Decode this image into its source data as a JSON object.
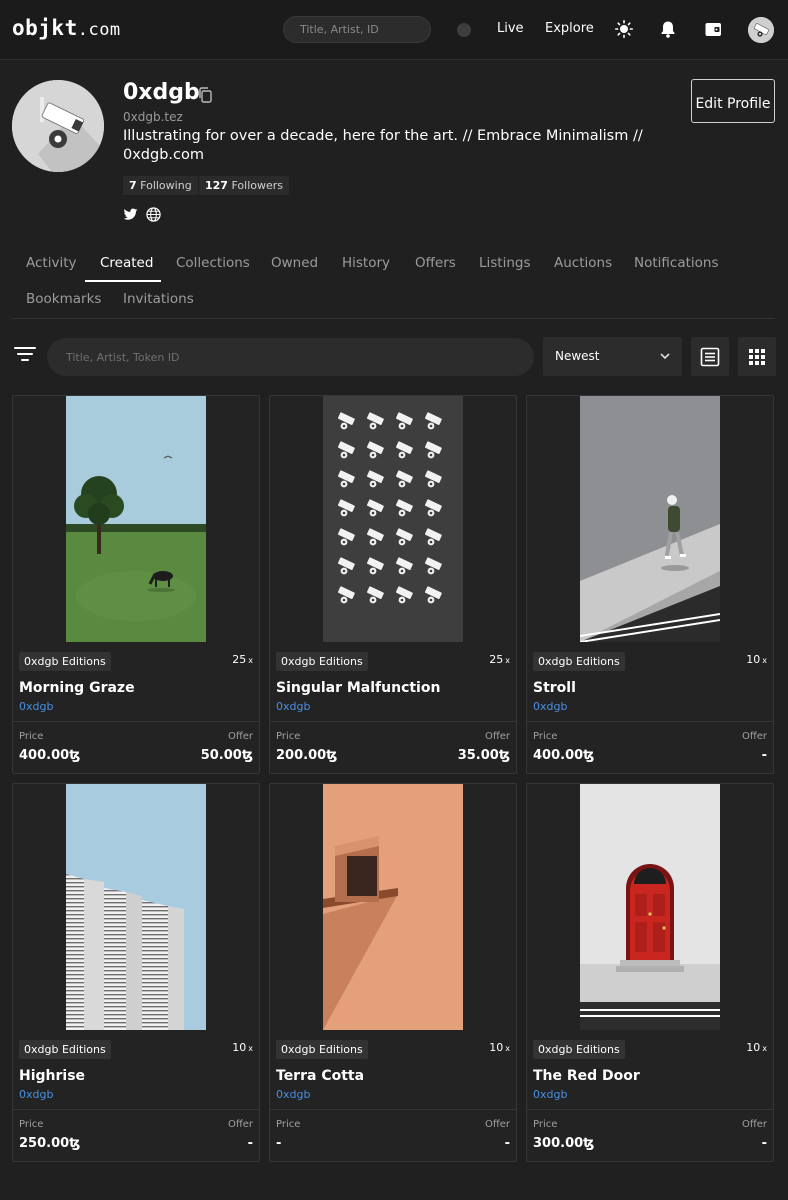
{
  "nav": {
    "logo_main": "objkt",
    "logo_suffix": ".com",
    "search_placeholder": "Title, Artist, ID",
    "live_label": "Live",
    "explore_label": "Explore",
    "icons": [
      "sun-icon",
      "bell-icon",
      "wallet-icon",
      "avatar"
    ]
  },
  "profile": {
    "name": "0xdgb",
    "handle": "0xdgb.tez",
    "bio": "Illustrating for over a decade, here for the art. // Embrace Minimalism // 0xdgb.com",
    "following_count": "7",
    "following_label": "Following",
    "followers_count": "127",
    "followers_label": "Followers",
    "edit_button": "Edit Profile",
    "socials": [
      "twitter-icon",
      "globe-icon"
    ]
  },
  "tabs": [
    {
      "label": "Activity",
      "active": false
    },
    {
      "label": "Created",
      "active": true
    },
    {
      "label": "Collections",
      "active": false
    },
    {
      "label": "Owned",
      "active": false
    },
    {
      "label": "History",
      "active": false
    },
    {
      "label": "Offers",
      "active": false
    },
    {
      "label": "Listings",
      "active": false
    },
    {
      "label": "Auctions",
      "active": false
    },
    {
      "label": "Notifications",
      "active": false
    },
    {
      "label": "Bookmarks",
      "active": false
    },
    {
      "label": "Invitations",
      "active": false
    }
  ],
  "filters": {
    "search_placeholder": "Title, Artist, Token ID",
    "sort_value": "Newest"
  },
  "card_labels": {
    "price": "Price",
    "offer": "Offer",
    "times": "x"
  },
  "cards": [
    {
      "collection": "0xdgb Editions",
      "editions": "25",
      "title": "Morning Graze",
      "artist": "0xdgb",
      "price": "400.00ꜩ",
      "offer": "50.00ꜩ"
    },
    {
      "collection": "0xdgb Editions",
      "editions": "25",
      "title": "Singular Malfunction",
      "artist": "0xdgb",
      "price": "200.00ꜩ",
      "offer": "35.00ꜩ"
    },
    {
      "collection": "0xdgb Editions",
      "editions": "10",
      "title": "Stroll",
      "artist": "0xdgb",
      "price": "400.00ꜩ",
      "offer": "-"
    },
    {
      "collection": "0xdgb Editions",
      "editions": "10",
      "title": "Highrise",
      "artist": "0xdgb",
      "price": "250.00ꜩ",
      "offer": "-"
    },
    {
      "collection": "0xdgb Editions",
      "editions": "10",
      "title": "Terra Cotta",
      "artist": "0xdgb",
      "price": "-",
      "offer": "-"
    },
    {
      "collection": "0xdgb Editions",
      "editions": "10",
      "title": "The Red Door",
      "artist": "0xdgb",
      "price": "300.00ꜩ",
      "offer": "-"
    }
  ]
}
